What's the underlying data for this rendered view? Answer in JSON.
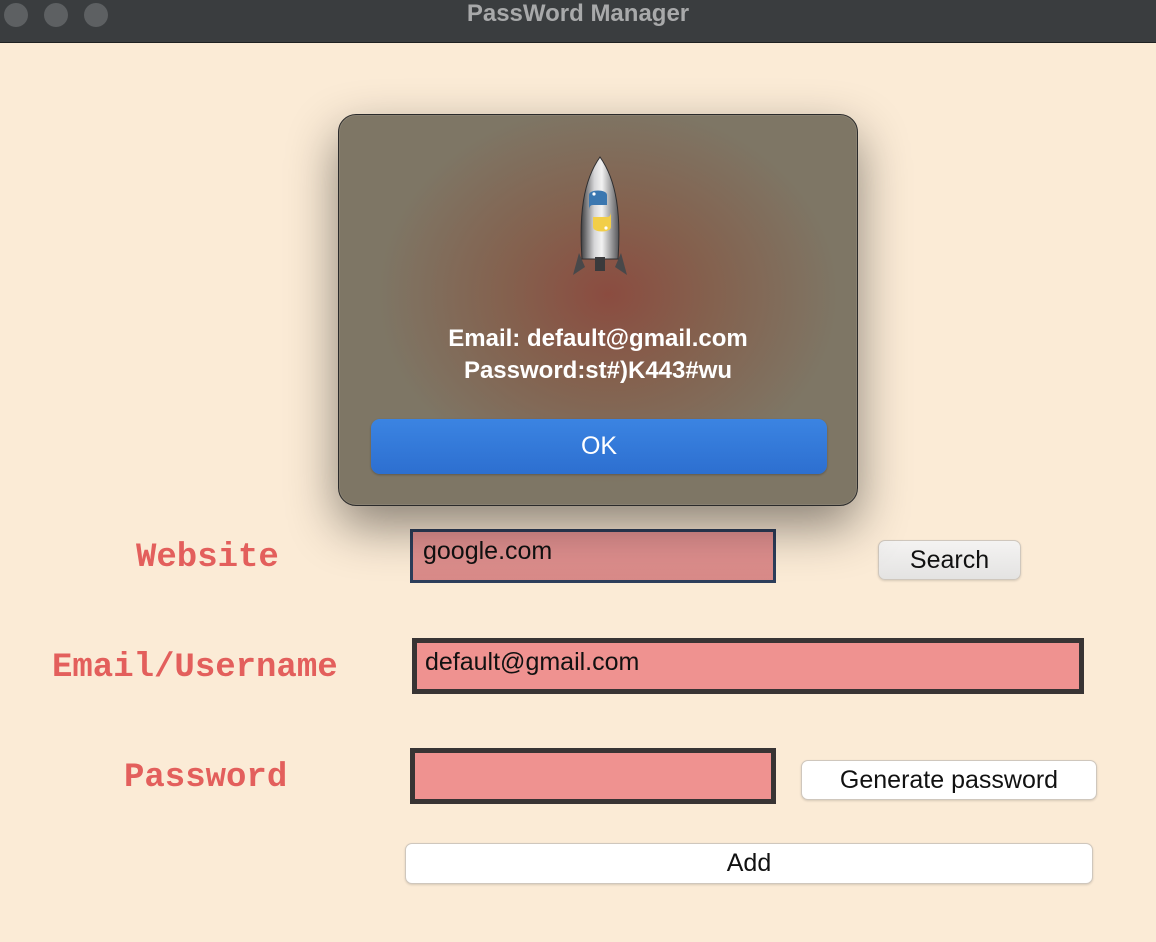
{
  "window": {
    "title": "PassWord Manager"
  },
  "alert": {
    "icon": "python-launcher-rocket-icon",
    "message_line1": "Email: default@gmail.com",
    "message_line2": "Password:st#)K443#wu",
    "ok_label": "OK"
  },
  "form": {
    "website_label": "Website",
    "website_value": "google.com",
    "search_label": "Search",
    "email_label": "Email/Username",
    "email_value": "default@gmail.com",
    "password_label": "Password",
    "password_value": "",
    "generate_label": "Generate password",
    "add_label": "Add"
  },
  "colors": {
    "background": "#fbebd6",
    "label": "#e35f5c",
    "entry_fill": "#ef9290",
    "accent_button": "#2f73d6"
  }
}
